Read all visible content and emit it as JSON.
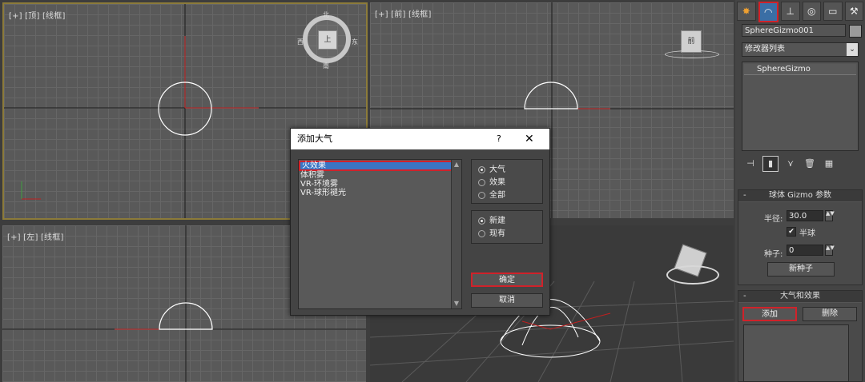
{
  "viewports": {
    "top": {
      "label": "[+] [顶] [线框]"
    },
    "front": {
      "label": "[+] [前] [线框]"
    },
    "left": {
      "label": "[+] [左] [线框]"
    }
  },
  "viewcube": {
    "top_face": "上",
    "front_face": "前",
    "compass": {
      "north": "北",
      "south": "南",
      "west": "西",
      "east": "东"
    }
  },
  "panel": {
    "tabs": [
      "create-icon",
      "modify-icon",
      "hierarchy-icon",
      "motion-icon",
      "display-icon",
      "utilities-icon"
    ],
    "object_name": "SphereGizmo001",
    "modifier_list": "修改器列表",
    "stack_items": [
      "SphereGizmo"
    ],
    "gizmo_params": {
      "title": "球体 Gizmo 参数",
      "radius_label": "半径:",
      "radius_value": "30.0",
      "hemisphere_label": "半球",
      "seed_label": "种子:",
      "seed_value": "0",
      "new_seed_button": "新种子"
    },
    "atmos": {
      "title": "大气和效果",
      "add_button": "添加",
      "delete_button": "删除"
    }
  },
  "dialog": {
    "title": "添加大气",
    "help": "?",
    "close": "✕",
    "items": [
      "火效果",
      "体积雾",
      "VR-环境雾",
      "VR-球形褪光"
    ],
    "selected_index": 0,
    "filter_options": [
      "大气",
      "效果",
      "全部"
    ],
    "filter_selected": 0,
    "source_options": [
      "新建",
      "现有"
    ],
    "source_selected": 0,
    "ok_button": "确定",
    "cancel_button": "取消"
  },
  "colors": {
    "highlight_red": "#d0222a",
    "selection_blue": "#3a75c4",
    "active_viewport_border": "#8c7b3a"
  }
}
